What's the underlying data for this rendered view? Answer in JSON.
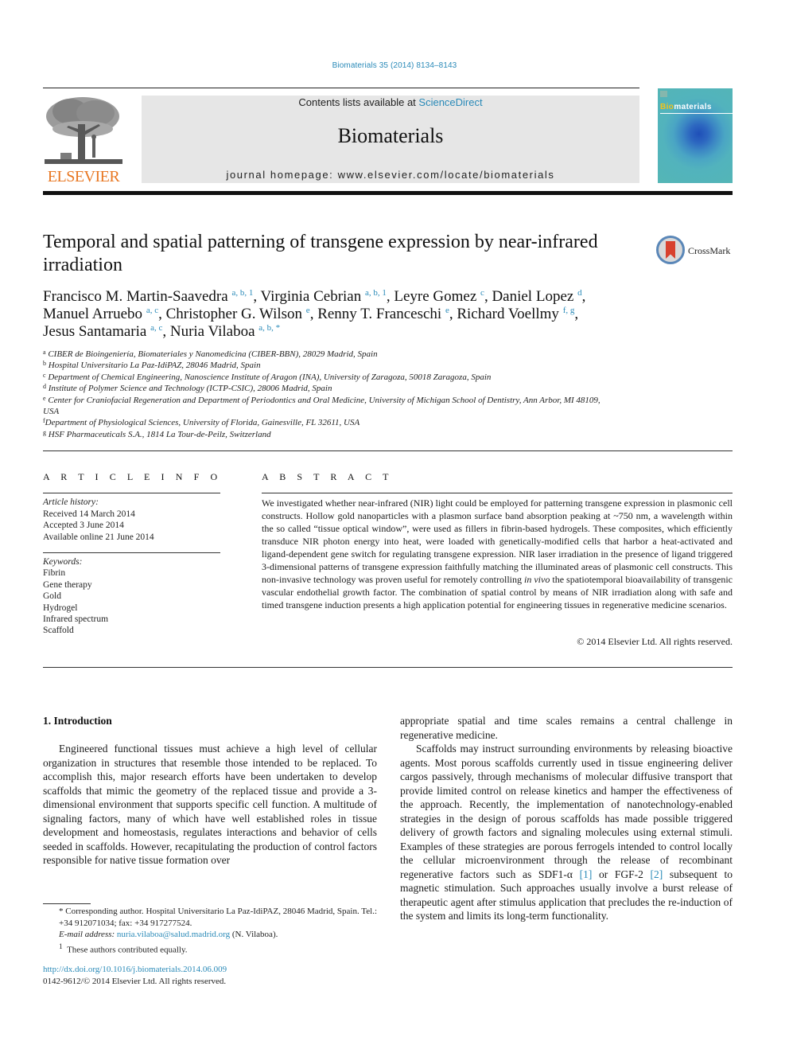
{
  "citation": "Biomaterials 35 (2014) 8134–8143",
  "header": {
    "publisher_logo_text": "ELSEVIER",
    "contents_prefix": "Contents lists available at ",
    "contents_link": "ScienceDirect",
    "journal_name": "Biomaterials",
    "homepage": "journal homepage: www.elsevier.com/locate/biomaterials",
    "cover_title_prefix": "Bio",
    "cover_title_suffix": "materials"
  },
  "article": {
    "title": "Temporal and spatial patterning of transgene expression by near-infrared irradiation",
    "crossmark_label": "CrossMark",
    "authors": [
      {
        "name": "Francisco M. Martin-Saavedra",
        "sup": "a, b, 1"
      },
      {
        "name": "Virginia Cebrian",
        "sup": "a, b, 1"
      },
      {
        "name": "Leyre Gomez",
        "sup": "c"
      },
      {
        "name": "Daniel Lopez",
        "sup": "d"
      },
      {
        "name": "Manuel Arruebo",
        "sup": "a, c"
      },
      {
        "name": "Christopher G. Wilson",
        "sup": "e"
      },
      {
        "name": "Renny T. Franceschi",
        "sup": "e"
      },
      {
        "name": "Richard Voellmy",
        "sup": "f, g"
      },
      {
        "name": "Jesus Santamaria",
        "sup": "a, c"
      },
      {
        "name": "Nuria Vilaboa",
        "sup": "a, b, *"
      }
    ],
    "affiliations": [
      {
        "key": "a",
        "text": "CIBER de Bioingeniería, Biomateriales y Nanomedicina (CIBER-BBN), 28029 Madrid, Spain"
      },
      {
        "key": "b",
        "text": "Hospital Universitario La Paz-IdiPAZ, 28046 Madrid, Spain"
      },
      {
        "key": "c",
        "text": "Department of Chemical Engineering, Nanoscience Institute of Aragon (INA), University of Zaragoza, 50018 Zaragoza, Spain"
      },
      {
        "key": "d",
        "text": "Institute of Polymer Science and Technology (ICTP-CSIC), 28006 Madrid, Spain"
      },
      {
        "key": "e",
        "text": "Center for Craniofacial Regeneration and Department of Periodontics and Oral Medicine, University of Michigan School of Dentistry, Ann Arbor, MI 48109, USA"
      },
      {
        "key": "f",
        "text": "Department of Physiological Sciences, University of Florida, Gainesville, FL 32611, USA"
      },
      {
        "key": "g",
        "text": "HSF Pharmaceuticals S.A., 1814 La Tour-de-Peilz, Switzerland"
      }
    ]
  },
  "article_info": {
    "heading": "A R T I C L E   I N F O",
    "history_label": "Article history:",
    "history": [
      "Received 14 March 2014",
      "Accepted 3 June 2014",
      "Available online 21 June 2014"
    ],
    "keywords_label": "Keywords:",
    "keywords": [
      "Fibrin",
      "Gene therapy",
      "Gold",
      "Hydrogel",
      "Infrared spectrum",
      "Scaffold"
    ]
  },
  "abstract": {
    "heading": "A B S T R A C T",
    "text_1": "We investigated whether near-infrared (NIR) light could be employed for patterning transgene expres­sion in plasmonic cell constructs. Hollow gold nanoparticles with a plasmon surface band absorption peaking at ~750 nm, a wavelength within the so called “tissue optical window”, were used as fillers in fibrin-based hydrogels. These composites, which efficiently transduce NIR photon energy into heat, were loaded with genetically-modified cells that harbor a heat-activated and ligand-dependent gene switch for regulating transgene expression. NIR laser irradiation in the presence of ligand triggered 3-dimensional patterns of transgene expression faithfully matching the illuminated areas of plasmonic cell constructs. This non-invasive technology was proven useful for remotely controlling ",
    "text_italic": "in vivo",
    "text_2": " the spatiotemporal bioavailability of transgenic vascular endothelial growth factor. The combination of spatial control by means of NIR irradiation along with safe and timed transgene induction presents a high application potential for engineering tissues in regenerative medicine scenarios.",
    "copyright": "© 2014 Elsevier Ltd. All rights reserved."
  },
  "body": {
    "section_heading": "1.  Introduction",
    "left_p1": "Engineered functional tissues must achieve a high level of cellular organization in structures that resemble those intended to be replaced. To accomplish this, major research efforts have been undertaken to develop scaffolds that mimic the geometry of the replaced tissue and provide a 3-dimensional environment that supports specific cell function. A multitude of signaling factors, many of which have well established roles in tissue development and homeostasis, regulates interactions and behavior of cells seeded in scaffolds. However, recapitulating the production of control factors responsible for native tissue formation over",
    "right_p0": "appropriate spatial and time scales remains a central challenge in regenerative medicine.",
    "right_p1_a": "Scaffolds may instruct surrounding environments by releasing bioactive agents. Most porous scaffolds currently used in tissue engineering deliver cargos passively, through mechanisms of mo­lecular diffusive transport that provide limited control on release kinetics and hamper the effectiveness of the approach. Recently, the implementation of nanotechnology-enabled strategies in the design of porous scaffolds has made possible triggered delivery of growth factors and signaling molecules using external stimuli. Examples of these strategies are porous ferrogels intended to control locally the cellular microenvironment through the release of recombinant regenerative factors such as SDF1-α ",
    "ref_1": "[1]",
    "right_p1_b": " or FGF-2 ",
    "ref_2": "[2]",
    "right_p1_c": " subsequent to magnetic stimulation. Such approaches usually involve a burst release of therapeutic agent after stimulus appli­cation that precludes the re-induction of the system and limits its long-term functionality."
  },
  "footnotes": {
    "corresponding": "* Corresponding author. Hospital Universitario La Paz-IdiPAZ, 28046 Madrid, Spain. Tel.: +34 912071034; fax: +34 917277524.",
    "email_label": "E-mail address: ",
    "email": "nuria.vilaboa@salud.madrid.org",
    "email_suffix": " (N. Vilaboa).",
    "equal_contrib_mark": "1",
    "equal_contrib": "These authors contributed equally.",
    "doi": "http://dx.doi.org/10.1016/j.biomaterials.2014.06.009",
    "issn": "0142-9612/© 2014 Elsevier Ltd. All rights reserved."
  },
  "colors": {
    "link": "#2a8ab8",
    "elsevier_orange": "#e87722",
    "header_box": "#e6e6e6"
  }
}
